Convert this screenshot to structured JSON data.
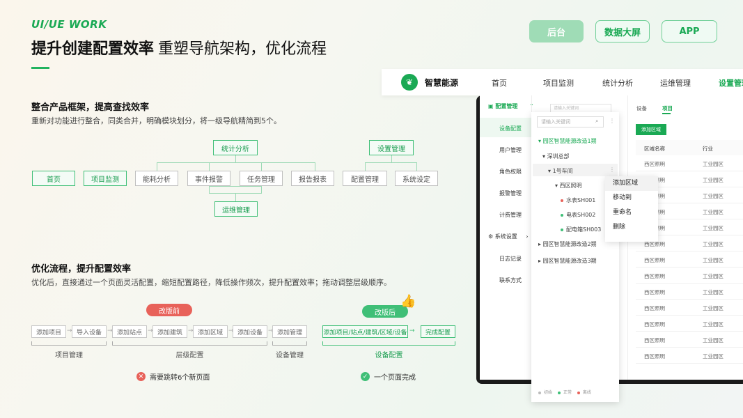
{
  "header": {
    "brand": "UI/UE WORK",
    "title_bold": "提升创建配置效率",
    "title_sub": "重塑导航架构，优化流程"
  },
  "tabs": [
    "后台",
    "数据大屏",
    "APP"
  ],
  "section1": {
    "title": "整合产品框架，提高查找效率",
    "desc": "重新对功能进行整合，同类合并，明确模块划分，将一级导航精简到5个。"
  },
  "nav_tree": {
    "top": [
      "统计分析",
      "设置管理"
    ],
    "row": [
      "首页",
      "项目监测",
      "能耗分析",
      "事件报警",
      "任务管理",
      "报告报表",
      "配置管理",
      "系统设定"
    ],
    "bottom": "运维管理"
  },
  "section2": {
    "title": "优化流程，提升配置效率",
    "desc": "优化后，直接通过一个页面灵活配置，缩短配置路径，降低操作频次，提升配置效率；拖动调整层级顺序。"
  },
  "before": {
    "badge": "改版前",
    "steps": [
      "添加项目",
      "导入设备",
      "添加站点",
      "添加建筑",
      "添加区域",
      "添加设备",
      "添加管理"
    ],
    "groups": [
      "项目管理",
      "层级配置",
      "设备管理"
    ],
    "result": "需要跳转6个新页面",
    "result_icon": "x-icon",
    "color": "#e8625a"
  },
  "after": {
    "badge": "改版后",
    "steps": [
      "添加项目/站点/建筑/区域/设备",
      "完成配置"
    ],
    "group": "设备配置",
    "result": "一个页面完成",
    "result_icon": "check-icon",
    "color": "#3fbf77"
  },
  "app": {
    "name": "智慧能源",
    "nav": [
      "首页",
      "项目监测",
      "统计分析",
      "运维管理",
      "设置管理"
    ],
    "sidebar": {
      "group1": "配置管理",
      "items": [
        "设备配置",
        "用户管理",
        "角色权限",
        "报警管理",
        "计费管理"
      ],
      "group2": "系统设置",
      "items2": [
        "日志记录",
        "联系方式"
      ]
    },
    "search_placeholder": "请输入关键词",
    "tree": [
      "园区智慧能源改造1期",
      "深圳总部",
      "1号车间",
      "西区照明",
      "水表SH001",
      "电表SH002",
      "配电箱SH003",
      "园区智慧能源改造2期",
      "园区智慧能源改造3期"
    ],
    "context_menu": [
      "添加区域",
      "移动到",
      "重命名",
      "删除"
    ],
    "legend": [
      "初始",
      "正常",
      "离线"
    ],
    "content_tabs": [
      "设备",
      "项目"
    ],
    "add_button": "添加区域",
    "table_headers": [
      "区域名称",
      "行业"
    ],
    "table_rows": [
      [
        "西区照明",
        "工业园区"
      ],
      [
        "西区照明",
        "工业园区"
      ],
      [
        "西区照明",
        "工业园区"
      ],
      [
        "西区照明",
        "工业园区"
      ],
      [
        "西区照明",
        "工业园区"
      ],
      [
        "西区照明",
        "工业园区"
      ],
      [
        "西区照明",
        "工业园区"
      ],
      [
        "西区照明",
        "工业园区"
      ],
      [
        "西区照明",
        "工业园区"
      ],
      [
        "西区照明",
        "工业园区"
      ],
      [
        "西区照明",
        "工业园区"
      ],
      [
        "西区照明",
        "工业园区"
      ],
      [
        "西区照明",
        "工业园区"
      ]
    ]
  },
  "colors": {
    "accent": "#1aa954",
    "warn": "#e8625a"
  }
}
